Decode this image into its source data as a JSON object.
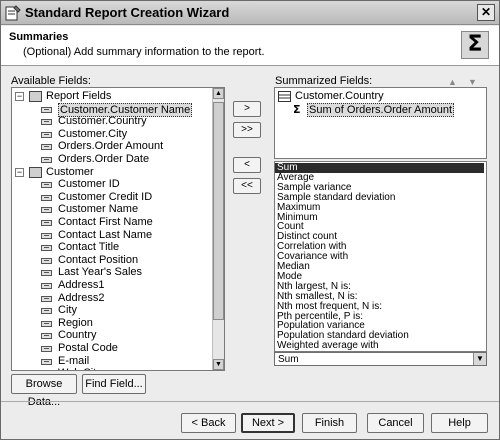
{
  "window": {
    "title": "Standard Report Creation Wizard",
    "close_glyph": "✕"
  },
  "header": {
    "title": "Summaries",
    "description": "(Optional) Add summary information to the report.",
    "icon": "Σ"
  },
  "available": {
    "label": "Available Fields:",
    "groups": [
      {
        "name": "Report Fields",
        "fields": [
          "Customer.Customer Name",
          "Customer.Country",
          "Customer.City",
          "Orders.Order Amount",
          "Orders.Order Date"
        ]
      },
      {
        "name": "Customer",
        "fields": [
          "Customer ID",
          "Customer Credit ID",
          "Customer Name",
          "Contact First Name",
          "Contact Last Name",
          "Contact Title",
          "Contact Position",
          "Last Year's Sales",
          "Address1",
          "Address2",
          "City",
          "Region",
          "Country",
          "Postal Code",
          "E-mail",
          "Web Site"
        ]
      }
    ],
    "selected": "Customer.Customer Name"
  },
  "move_buttons": {
    "add": ">",
    "add_all": ">>",
    "remove": "<",
    "remove_all": "<<"
  },
  "summarized": {
    "label": "Summarized Fields:",
    "group": "Customer.Country",
    "items": [
      "Sum of Orders.Order Amount"
    ]
  },
  "summary_functions": {
    "options": [
      "Sum",
      "Average",
      "Sample variance",
      "Sample standard deviation",
      "Maximum",
      "Minimum",
      "Count",
      "Distinct count",
      "Correlation with",
      "Covariance with",
      "Median",
      "Mode",
      "Nth largest, N is:",
      "Nth smallest, N is:",
      "Nth most frequent, N is:",
      "Pth percentile, P is:",
      "Population variance",
      "Population standard deviation",
      "Weighted average with"
    ],
    "highlighted": "Sum",
    "selected_value": "Sum"
  },
  "left_buttons": {
    "browse": "Browse Data...",
    "find": "Find Field..."
  },
  "footer": {
    "back": "< Back",
    "next": "Next >",
    "finish": "Finish",
    "cancel": "Cancel",
    "help": "Help"
  }
}
